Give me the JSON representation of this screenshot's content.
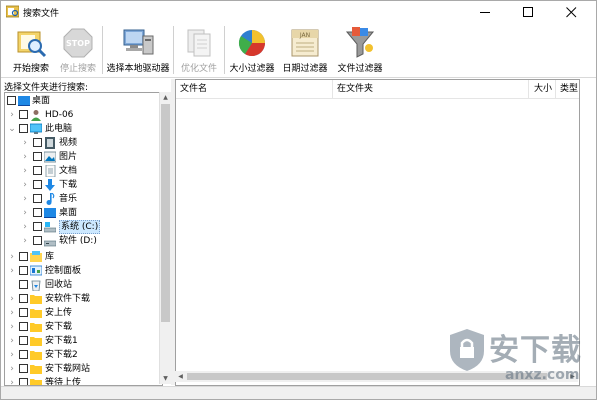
{
  "window": {
    "title": "搜索文件",
    "controls": [
      "minimize-icon",
      "maximize-icon",
      "close-icon"
    ]
  },
  "toolbar": {
    "buttons": [
      {
        "label": "开始搜索",
        "icon": "search-start-icon",
        "enabled": true
      },
      {
        "label": "停止搜索",
        "icon": "stop-icon",
        "enabled": false
      },
      {
        "label": "选择本地驱动器",
        "icon": "local-drive-icon",
        "enabled": true
      },
      {
        "label": "优化文件",
        "icon": "optimize-files-icon",
        "enabled": false
      },
      {
        "label": "大小过滤器",
        "icon": "size-filter-icon",
        "enabled": true
      },
      {
        "label": "日期过滤器",
        "icon": "date-filter-icon",
        "enabled": true
      },
      {
        "label": "文件过滤器",
        "icon": "file-filter-icon",
        "enabled": true
      }
    ]
  },
  "tree": {
    "header": "选择文件夹进行搜索:",
    "items": [
      {
        "label": "桌面",
        "icon": "desktop-icon"
      },
      {
        "label": "HD-06",
        "icon": "user-icon"
      },
      {
        "label": "此电脑",
        "icon": "computer-icon"
      },
      {
        "label": "视频",
        "icon": "video-folder-icon"
      },
      {
        "label": "图片",
        "icon": "pictures-folder-icon"
      },
      {
        "label": "文档",
        "icon": "documents-folder-icon"
      },
      {
        "label": "下载",
        "icon": "downloads-icon"
      },
      {
        "label": "音乐",
        "icon": "music-icon"
      },
      {
        "label": "桌面",
        "icon": "desktop-icon"
      },
      {
        "label": "系统 (C:)",
        "icon": "system-drive-icon"
      },
      {
        "label": "软件 (D:)",
        "icon": "drive-icon"
      },
      {
        "label": "库",
        "icon": "library-icon"
      },
      {
        "label": "控制面板",
        "icon": "control-panel-icon"
      },
      {
        "label": "回收站",
        "icon": "recycle-bin-icon"
      },
      {
        "label": "安软件下载",
        "icon": "folder-icon"
      },
      {
        "label": "安上传",
        "icon": "folder-icon"
      },
      {
        "label": "安下载",
        "icon": "folder-icon"
      },
      {
        "label": "安下载1",
        "icon": "folder-icon"
      },
      {
        "label": "安下载2",
        "icon": "folder-icon"
      },
      {
        "label": "安下载网站",
        "icon": "folder-icon"
      },
      {
        "label": "等待上传",
        "icon": "folder-icon"
      }
    ]
  },
  "results": {
    "columns": [
      "文件名",
      "在文件夹",
      "大小",
      "类型"
    ]
  },
  "watermark": {
    "text": "安下载",
    "sub": "anxz.com",
    "icon": "shield-lock-icon"
  }
}
